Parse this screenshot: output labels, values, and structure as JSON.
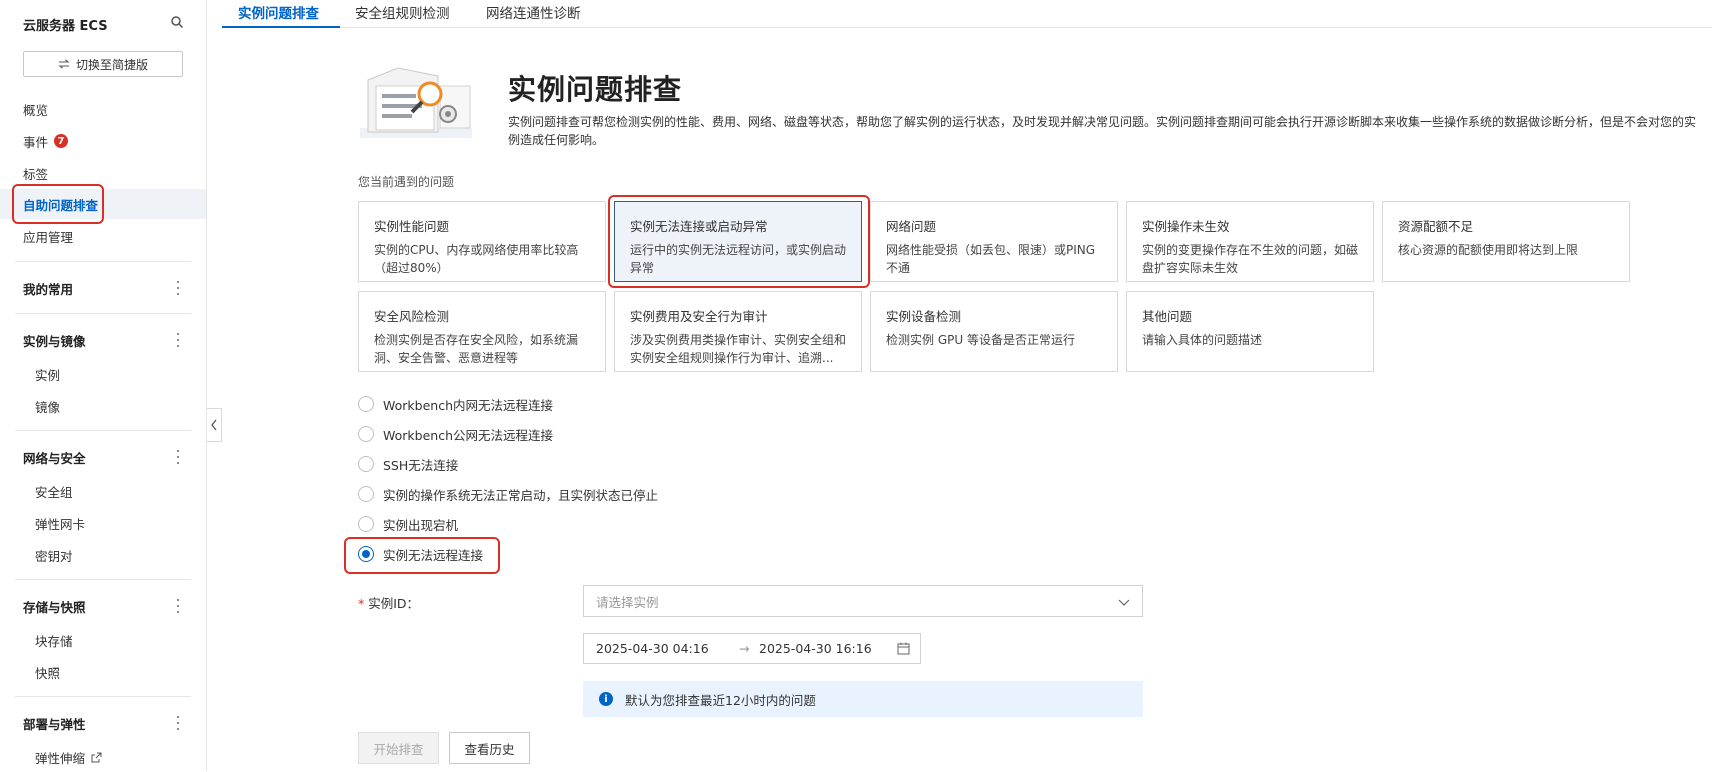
{
  "sidebar": {
    "title": "云服务器 ECS",
    "switch_label": "切换至简捷版",
    "items": {
      "overview": "概览",
      "events": "事件",
      "events_badge": "7",
      "tags": "标签",
      "self_troubleshoot": "自助问题排查",
      "app_mgmt": "应用管理",
      "my_common": "我的常用",
      "instances_images": "实例与镜像",
      "instance": "实例",
      "image": "镜像",
      "network_security": "网络与安全",
      "security_group": "安全组",
      "eni": "弹性网卡",
      "keypair": "密钥对",
      "storage_snapshot": "存储与快照",
      "block_storage": "块存储",
      "snapshot": "快照",
      "deploy_elastic": "部署与弹性",
      "auto_scaling": "弹性伸缩"
    }
  },
  "tabs": [
    "实例问题排查",
    "安全组规则检测",
    "网络连通性诊断"
  ],
  "hero": {
    "title": "实例问题排查",
    "description": "实例问题排查可帮您检测实例的性能、费用、网络、磁盘等状态，帮助您了解实例的运行状态，及时发现并解决常见问题。实例问题排查期间可能会执行开源诊断脚本来收集一些操作系统的数据做诊断分析，但是不会对您的实例造成任何影响。"
  },
  "section_label": "您当前遇到的问题",
  "cards": [
    {
      "title": "实例性能问题",
      "desc": "实例的CPU、内存或网络使用率比较高（超过80%）"
    },
    {
      "title": "实例无法连接或启动异常",
      "desc": "运行中的实例无法远程访问，或实例启动异常"
    },
    {
      "title": "网络问题",
      "desc": "网络性能受损（如丢包、限速）或PING不通"
    },
    {
      "title": "实例操作未生效",
      "desc": "实例的变更操作存在不生效的问题，如磁盘扩容实际未生效"
    },
    {
      "title": "资源配额不足",
      "desc": "核心资源的配额使用即将达到上限"
    },
    {
      "title": "安全风险检测",
      "desc": "检测实例是否存在安全风险，如系统漏洞、安全告警、恶意进程等"
    },
    {
      "title": "实例费用及安全行为审计",
      "desc": "涉及实例费用类操作审计、实例安全组和实例安全组规则操作行为审计、追溯..."
    },
    {
      "title": "实例设备检测",
      "desc": "检测实例 GPU 等设备是否正常运行"
    },
    {
      "title": "其他问题",
      "desc": "请输入具体的问题描述"
    }
  ],
  "radios": [
    {
      "label": "Workbench内网无法远程连接",
      "checked": false
    },
    {
      "label": "Workbench公网无法远程连接",
      "checked": false
    },
    {
      "label": "SSH无法连接",
      "checked": false
    },
    {
      "label": "实例的操作系统无法正常启动，且实例状态已停止",
      "checked": false
    },
    {
      "label": "实例出现宕机",
      "checked": false
    },
    {
      "label": "实例无法远程连接",
      "checked": true
    }
  ],
  "form": {
    "required_mark": "*",
    "instance_label": "实例ID：",
    "instance_placeholder": "请选择实例",
    "date_start": "2025-04-30 04:16",
    "date_arrow": "→",
    "date_end": "2025-04-30 16:16",
    "info_text": "默认为您排查最近12小时内的问题"
  },
  "buttons": {
    "start": "开始排查",
    "history": "查看历史"
  },
  "colors": {
    "accent": "#0064c8",
    "highlight_box": "#d93026",
    "info_bg": "#e8f3ff"
  }
}
